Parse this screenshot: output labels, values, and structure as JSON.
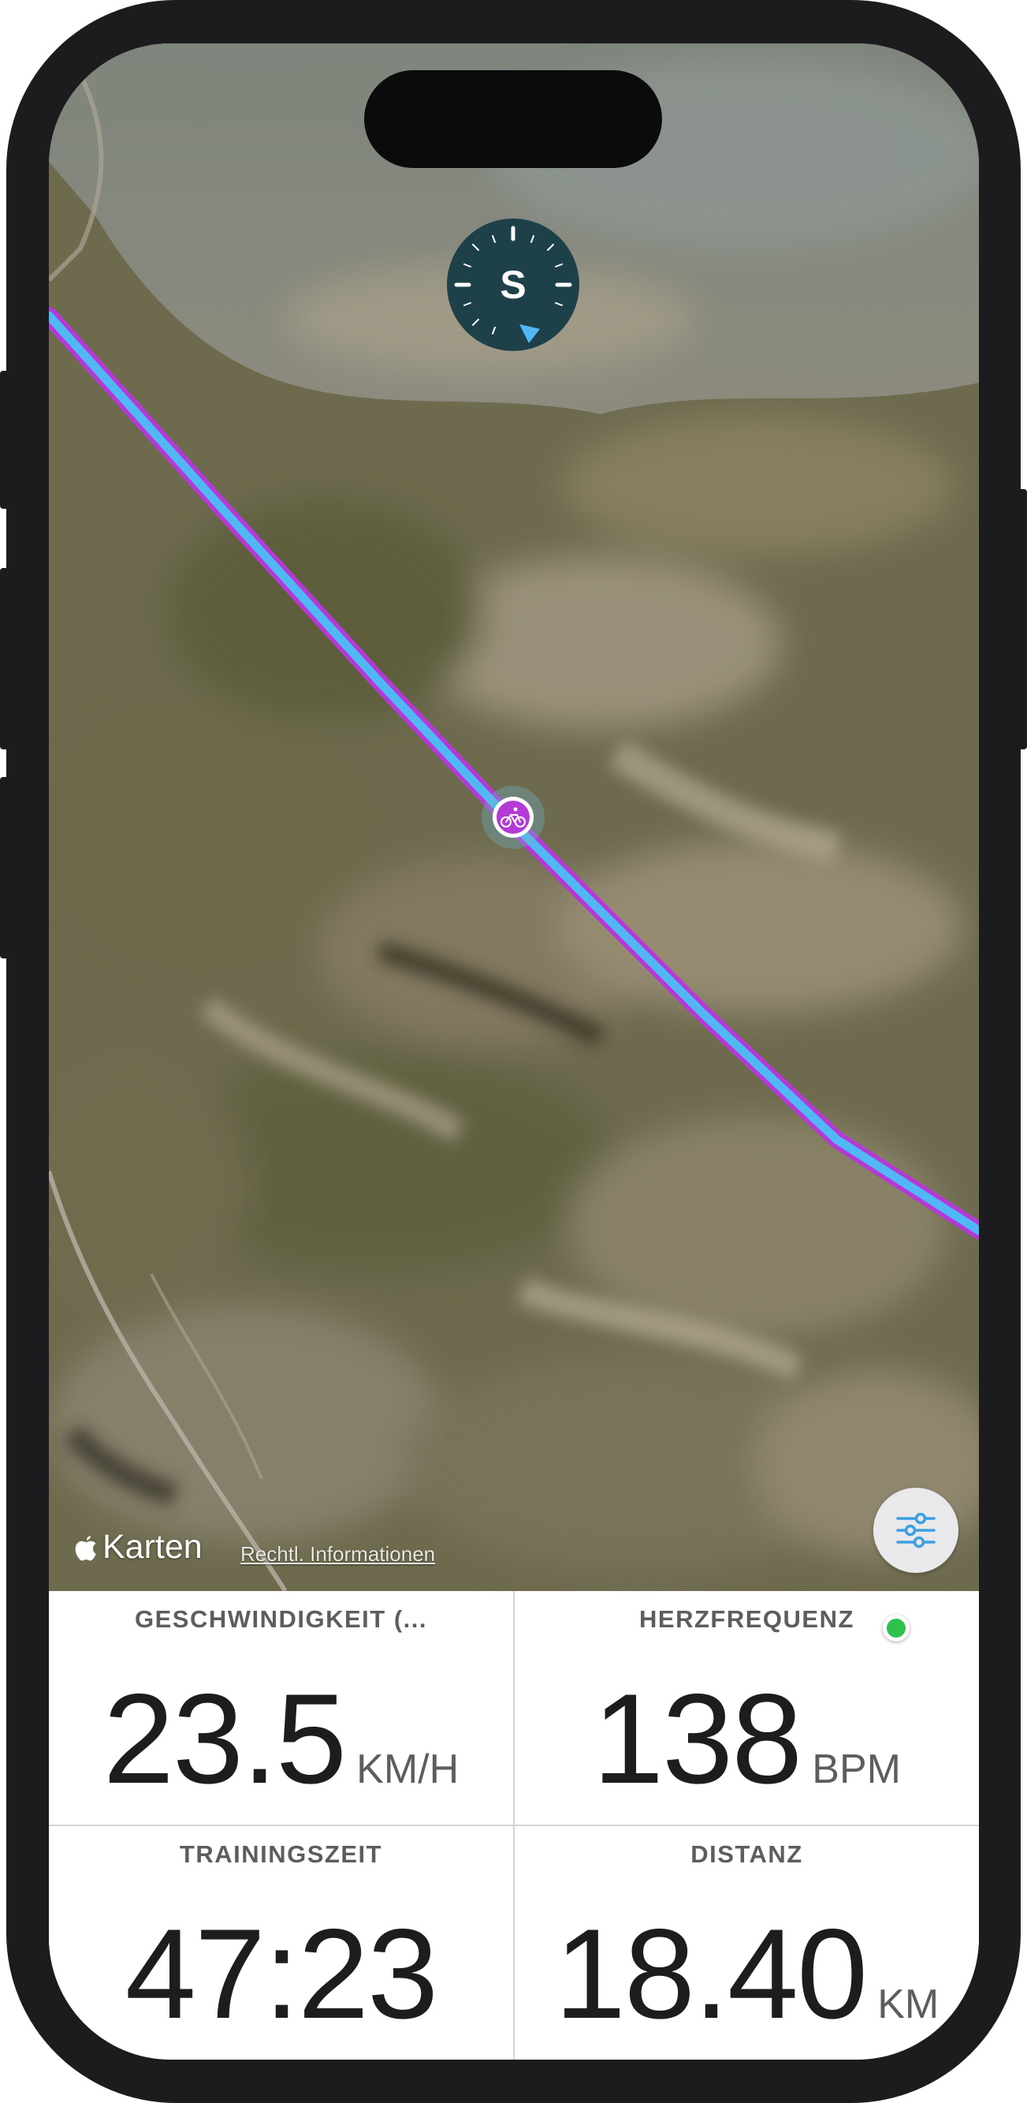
{
  "map": {
    "brand_label": "Karten",
    "legal_link": "Rechtl. Informationen",
    "compass_heading": "S",
    "route_colors": {
      "outline": "#b43ad6",
      "line": "#52b8f5"
    },
    "rider_marker_color": "#b43ad6",
    "icons": [
      "compass-icon",
      "cycling-icon",
      "apple-logo-icon",
      "filter-sliders-icon"
    ]
  },
  "stats": {
    "speed": {
      "label": "GESCHWINDIGKEIT (...",
      "value": "23.5",
      "unit": "KM/H"
    },
    "heart_rate": {
      "label": "HERZFREQUENZ",
      "value": "138",
      "unit": "BPM",
      "status_color": "#2ec24d"
    },
    "training_time": {
      "label": "TRAININGSZEIT",
      "value": "47:23"
    },
    "distance": {
      "label": "DISTANZ",
      "value": "18.40",
      "unit": "KM"
    }
  }
}
